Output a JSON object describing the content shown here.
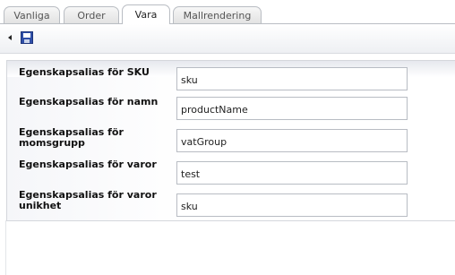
{
  "tabs": [
    {
      "label": "Vanliga",
      "active": false
    },
    {
      "label": "Order",
      "active": false
    },
    {
      "label": "Vara",
      "active": true
    },
    {
      "label": "Mallrendering",
      "active": false
    }
  ],
  "toolbar": {
    "back_icon": "arrow-left-icon",
    "save_icon": "save-icon"
  },
  "form": {
    "fields": [
      {
        "label": "Egenskapsalias för SKU",
        "value": "sku"
      },
      {
        "label": "Egenskapsalias för namn",
        "value": "productName"
      },
      {
        "label": "Egenskapsalias för momsgrupp",
        "value": "vatGroup"
      },
      {
        "label": "Egenskapsalias för varor",
        "value": "test"
      },
      {
        "label": "Egenskapsalias för varor unikhet",
        "value": "sku"
      }
    ]
  },
  "colors": {
    "accent": "#2f4fa8",
    "border": "#b9bdc3"
  }
}
